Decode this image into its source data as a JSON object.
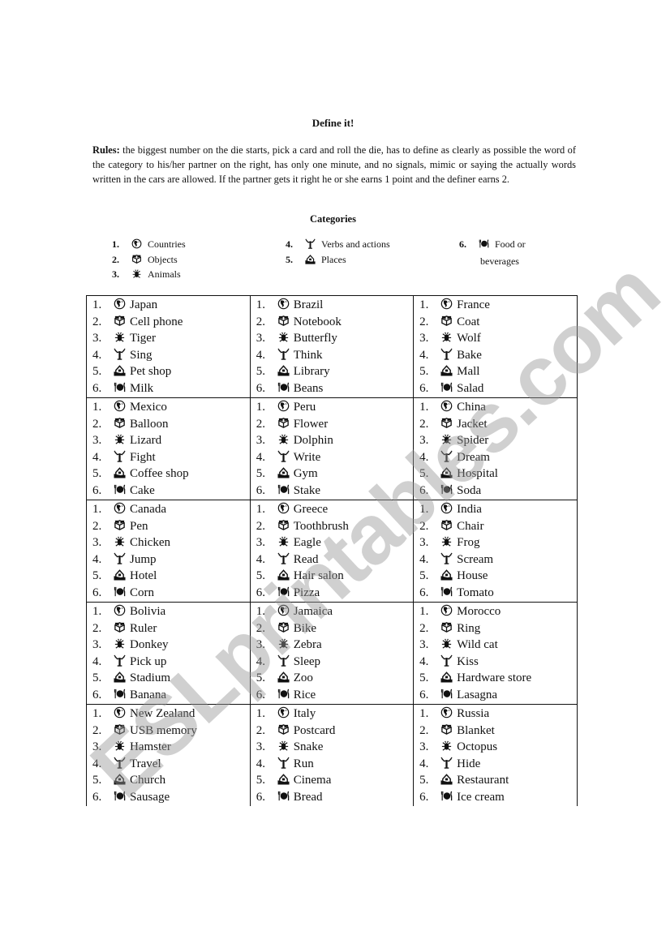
{
  "title": "Define it!",
  "rules": {
    "label": "Rules:",
    "text": " the biggest number on the die starts, pick a card and roll the die, has to define as clearly as possible the word of the category to his/her partner on the right, has only one minute, and no signals, mimic or saying the actually words written in the cars are allowed. If the partner gets it right he or she earns 1 point and the definer earns 2."
  },
  "categories": {
    "heading": "Categories",
    "items": [
      {
        "num": "1.",
        "icon": "globe-icon",
        "label": "Countries"
      },
      {
        "num": "2.",
        "icon": "gift-box-icon",
        "label": "Objects"
      },
      {
        "num": "3.",
        "icon": "bug-icon",
        "label": "Animals"
      },
      {
        "num": "4.",
        "icon": "antenna-icon",
        "label": "Verbs and actions"
      },
      {
        "num": "5.",
        "icon": "house-icon",
        "label": "Places"
      },
      {
        "num": "6.",
        "icon": "dining-icon",
        "label": "Food or",
        "label2": "beverages"
      }
    ]
  },
  "cards": [
    [
      {
        "words": [
          "Japan",
          "Cell phone",
          "Tiger",
          "Sing",
          "Pet shop",
          "Milk"
        ]
      },
      {
        "words": [
          "Brazil",
          "Notebook",
          "Butterfly",
          "Think",
          "Library",
          "Beans"
        ]
      },
      {
        "words": [
          "France",
          "Coat",
          "Wolf",
          "Bake",
          "Mall",
          "Salad"
        ]
      }
    ],
    [
      {
        "words": [
          "Mexico",
          "Balloon",
          "Lizard",
          "Fight",
          "Coffee shop",
          "Cake"
        ]
      },
      {
        "words": [
          "Peru",
          "Flower",
          "Dolphin",
          "Write",
          "Gym",
          "Stake"
        ]
      },
      {
        "words": [
          "China",
          "Jacket",
          "Spider",
          "Dream",
          "Hospital",
          "Soda"
        ]
      }
    ],
    [
      {
        "words": [
          "Canada",
          "Pen",
          "Chicken",
          "Jump",
          "Hotel",
          "Corn"
        ]
      },
      {
        "words": [
          "Greece",
          "Toothbrush",
          "Eagle",
          "Read",
          "Hair salon",
          "Pizza"
        ]
      },
      {
        "words": [
          "India",
          "Chair",
          "Frog",
          "Scream",
          "House",
          "Tomato"
        ]
      }
    ],
    [
      {
        "words": [
          "Bolivia",
          "Ruler",
          "Donkey",
          "Pick up",
          "Stadium",
          "Banana"
        ]
      },
      {
        "words": [
          "Jamaica",
          "Bike",
          "Zebra",
          "Sleep",
          "Zoo",
          "Rice"
        ]
      },
      {
        "words": [
          "Morocco",
          "Ring",
          "Wild cat",
          "Kiss",
          "Hardware store",
          "Lasagna"
        ]
      }
    ],
    [
      {
        "words": [
          "New Zealand",
          "USB memory",
          "Hamster",
          "Travel",
          "Church",
          "Sausage"
        ]
      },
      {
        "words": [
          "Italy",
          "Postcard",
          "Snake",
          "Run",
          "Cinema",
          "Bread"
        ]
      },
      {
        "words": [
          "Russia",
          "Blanket",
          "Octopus",
          "Hide",
          "Restaurant",
          "Ice cream"
        ]
      }
    ]
  ],
  "numbers": [
    "1.",
    "2.",
    "3.",
    "4.",
    "5.",
    "6."
  ],
  "icon_names": [
    "globe-icon",
    "gift-box-icon",
    "bug-icon",
    "antenna-icon",
    "house-icon",
    "dining-icon"
  ],
  "watermark": "ESLprintables.com"
}
